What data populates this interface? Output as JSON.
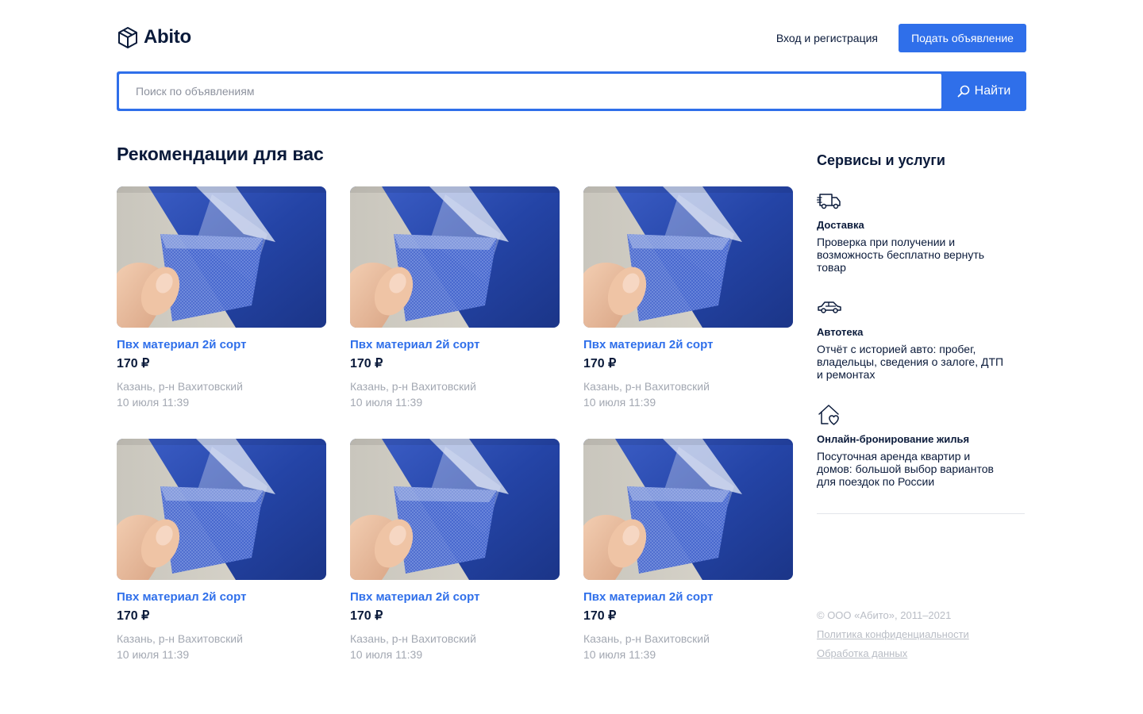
{
  "header": {
    "logo_text": "Abito",
    "login_label": "Вход и регистрация",
    "post_button_label": "Подать объявление"
  },
  "search": {
    "placeholder": "Поиск по объявлениям",
    "button_label": "Найти"
  },
  "recommendations": {
    "title": "Рекомендации для вас",
    "items": [
      {
        "title": "Пвх материал 2й сорт",
        "price": "170 ₽",
        "location": "Казань, р-н Вахитовский",
        "date": "10 июля 11:39"
      },
      {
        "title": "Пвх материал 2й сорт",
        "price": "170 ₽",
        "location": "Казань, р-н Вахитовский",
        "date": "10 июля 11:39"
      },
      {
        "title": "Пвх материал 2й сорт",
        "price": "170 ₽",
        "location": "Казань, р-н Вахитовский",
        "date": "10 июля 11:39"
      },
      {
        "title": "Пвх материал 2й сорт",
        "price": "170 ₽",
        "location": "Казань, р-н Вахитовский",
        "date": "10 июля 11:39"
      },
      {
        "title": "Пвх материал 2й сорт",
        "price": "170 ₽",
        "location": "Казань, р-н Вахитовский",
        "date": "10 июля 11:39"
      },
      {
        "title": "Пвх материал 2й сорт",
        "price": "170 ₽",
        "location": "Казань, р-н Вахитовский",
        "date": "10 июля 11:39"
      }
    ]
  },
  "services": {
    "title": "Сервисы и услуги",
    "items": [
      {
        "icon": "delivery-truck-icon",
        "name": "Доставка",
        "description": "Проверка при получении и возможность бесплатно вернуть товар"
      },
      {
        "icon": "car-icon",
        "name": "Автотека",
        "description": "Отчёт с историей авто: пробег, владельцы, сведения о залоге, ДТП и ремонтах"
      },
      {
        "icon": "house-heart-icon",
        "name": "Онлайн-бронирование жилья",
        "description": "Посуточная аренда квартир и домов: большой выбор вариантов для поездок по России"
      }
    ]
  },
  "footer": {
    "copyright": "© ООО «Абито», 2011–2021",
    "privacy_link": "Политика конфиденциальности",
    "data_link": "Обработка данных"
  },
  "colors": {
    "accent": "#2f6fea",
    "text_dark": "#0a1a3a",
    "text_muted": "#a3a8b2",
    "product_blue": "#2444a6"
  }
}
